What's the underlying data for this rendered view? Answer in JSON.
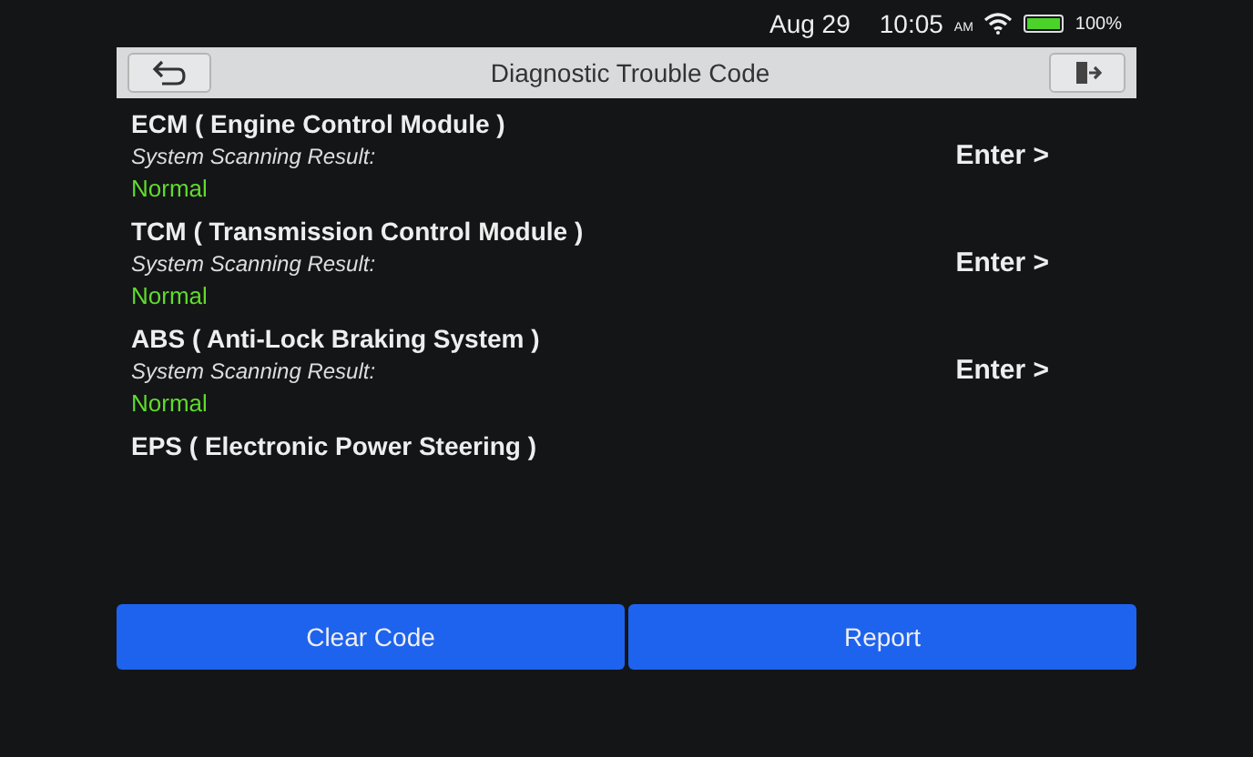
{
  "status_bar": {
    "date": "Aug 29",
    "time": "10:05",
    "meridiem": "AM",
    "battery": "100%"
  },
  "title_bar": {
    "title": "Diagnostic Trouble Code"
  },
  "systems": [
    {
      "name": "ECM ( Engine Control Module )",
      "result_label": "System Scanning Result:",
      "result": "Normal",
      "normal": true,
      "action": "Enter >"
    },
    {
      "name": "TCM ( Transmission Control Module )",
      "result_label": "System Scanning Result:",
      "result": "Normal",
      "normal": true,
      "action": "Enter >"
    },
    {
      "name": "ABS ( Anti-Lock Braking System )",
      "result_label": "System Scanning Result:",
      "result": "Normal",
      "normal": true,
      "action": "Enter >"
    },
    {
      "name": "EPS ( Electronic Power Steering )"
    }
  ],
  "buttons": [
    "Clear Code",
    "Report"
  ]
}
